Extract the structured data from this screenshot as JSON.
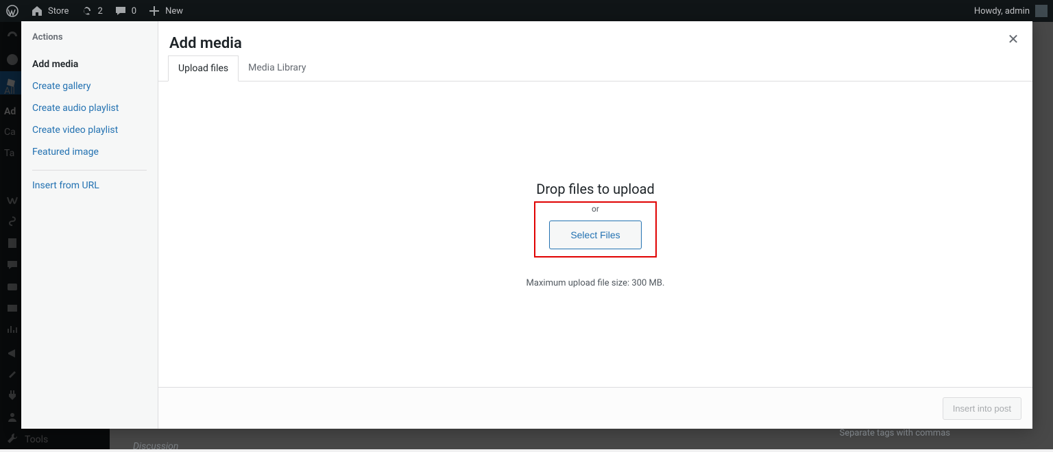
{
  "adminbar": {
    "site": "Store",
    "updates": "2",
    "comments": "0",
    "new": "New",
    "howdy": "Howdy, admin"
  },
  "sidebar_bg": {
    "items": [
      "All",
      "Ad",
      "Ca",
      "Ta"
    ],
    "tools": "Tools"
  },
  "bg": {
    "tags_hint": "Separate tags with commas",
    "discussion": "Discussion"
  },
  "modal": {
    "actions_heading": "Actions",
    "actions": {
      "add_media": "Add media",
      "create_gallery": "Create gallery",
      "create_audio": "Create audio playlist",
      "create_video": "Create video playlist",
      "featured": "Featured image",
      "insert_url": "Insert from URL"
    },
    "title": "Add media",
    "tabs": {
      "upload": "Upload files",
      "library": "Media Library"
    },
    "upload": {
      "drop": "Drop files to upload",
      "or": "or",
      "select": "Select Files",
      "max": "Maximum upload file size: 300 MB."
    },
    "footer": {
      "insert": "Insert into post"
    }
  }
}
